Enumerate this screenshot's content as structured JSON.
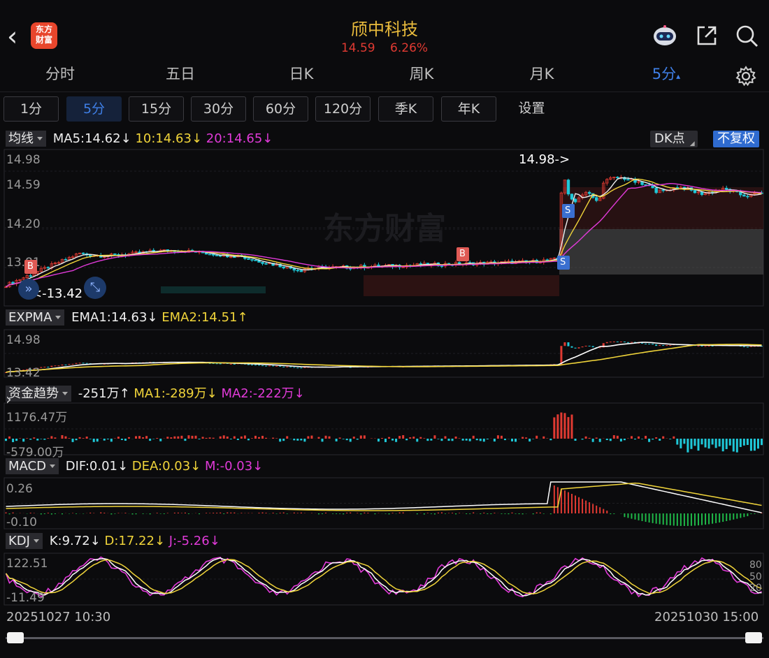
{
  "header": {
    "logo_line1": "东方",
    "logo_line2": "财富",
    "stock_name": "颀中科技",
    "price": "14.59",
    "change_pct": "6.26%"
  },
  "tabs": [
    {
      "label": "分时"
    },
    {
      "label": "五日"
    },
    {
      "label": "日K"
    },
    {
      "label": "周K"
    },
    {
      "label": "月K"
    },
    {
      "label": "5分"
    }
  ],
  "active_tab_arrow": "▴",
  "periods": [
    {
      "label": "1分"
    },
    {
      "label": "5分"
    },
    {
      "label": "15分"
    },
    {
      "label": "30分"
    },
    {
      "label": "60分"
    },
    {
      "label": "120分"
    },
    {
      "label": "季K"
    },
    {
      "label": "年K"
    },
    {
      "label": "设置"
    }
  ],
  "main_chart": {
    "indicator": "均线",
    "ma5": "MA5:14.62↓",
    "ma10": "10:14.63↓",
    "ma20": "20:14.65↓",
    "dk_button": "DK点",
    "adjust_button": "不复权",
    "y_labels": [
      "14.98",
      "14.59",
      "14.20",
      "13.81"
    ],
    "high_marker": "14.98->",
    "low_marker": "<-13.42",
    "watermark": "东方财富",
    "buy_tag": "B",
    "sell_tag": "S"
  },
  "expma": {
    "indicator": "EXPMA",
    "ema1": "EMA1:14.63↓",
    "ema2": "EMA2:14.51↑",
    "y_top": "14.98",
    "y_bottom": "13.42"
  },
  "fund": {
    "indicator": "资金趋势",
    "value": "-251万↑",
    "ma1": "MA1:-289万↓",
    "ma2": "MA2:-222万↓",
    "y_top": "1176.47万",
    "y_bottom": "-579.00万"
  },
  "macd": {
    "indicator": "MACD",
    "dif": "DIF:0.01↓",
    "dea": "DEA:0.03↓",
    "m": "M:-0.03↓",
    "y_top": "0.26",
    "y_bottom": "-0.10"
  },
  "kdj": {
    "indicator": "KDJ",
    "k": "K:9.72↓",
    "d": "D:17.22↓",
    "j": "J:-5.26↓",
    "y_top": "122.51",
    "y_bottom": "-11.49",
    "levels": [
      "80",
      "50",
      "20"
    ]
  },
  "footer": {
    "start_date": "20251027 10:30",
    "end_date": "20251030 15:00"
  },
  "colors": {
    "up": "#e03a32",
    "down": "#1fc8d8",
    "ma5": "#eeeeee",
    "ma10": "#f0d43a",
    "ma20": "#e03ad8",
    "accent": "#3f7fe6",
    "title": "#e9bb3c"
  }
}
